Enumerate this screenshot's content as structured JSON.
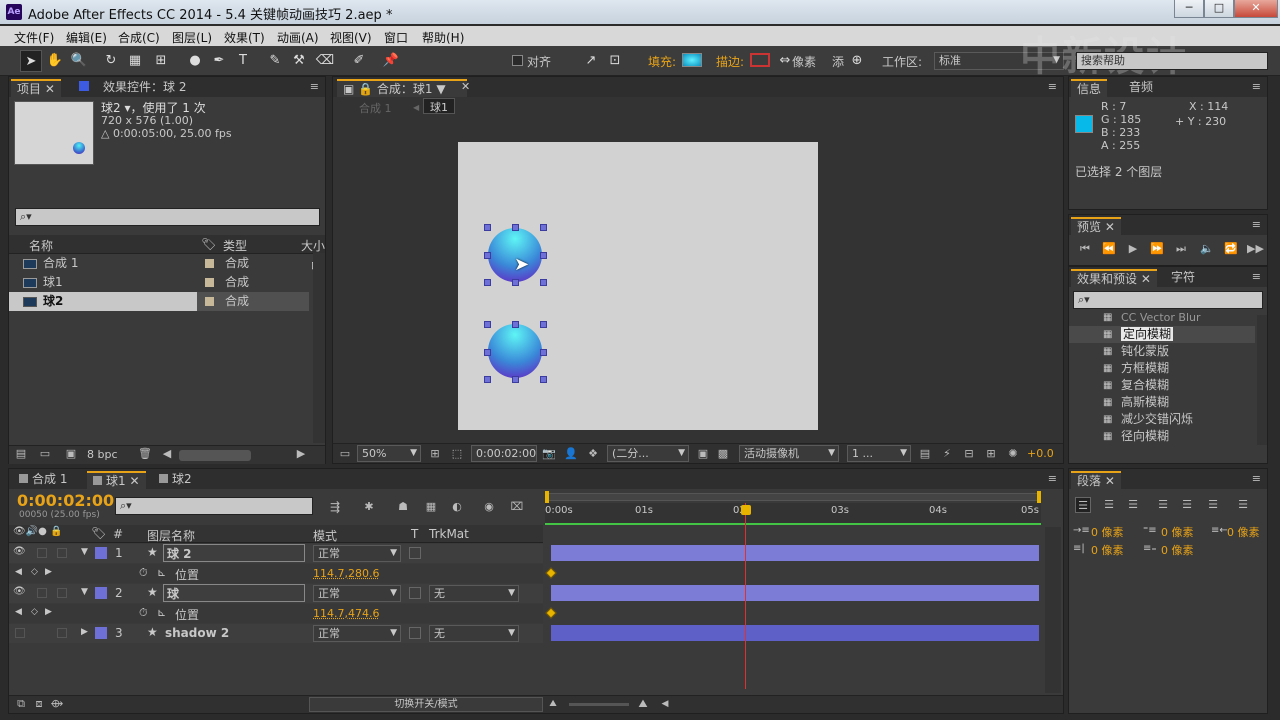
{
  "window": {
    "title": "Adobe After Effects CC 2014 - 5.4 关键帧动画技巧 2.aep *",
    "app_icon": "Ae",
    "min": "─",
    "max": "□",
    "close": "✕"
  },
  "menu": [
    "文件(F)",
    "编辑(E)",
    "合成(C)",
    "图层(L)",
    "效果(T)",
    "动画(A)",
    "视图(V)",
    "窗口",
    "帮助(H)"
  ],
  "toolbar": {
    "snap_label": "对齐",
    "fill_label": "填充:",
    "stroke_label": "描边:",
    "stroke_unit": "像素",
    "add_label": "添",
    "workspace_label": "工作区:",
    "workspace_value": "标准",
    "search_help": "搜索帮助",
    "fill_color": "#18b9e9"
  },
  "watermark": "中新设计",
  "project": {
    "tab_label": "项目",
    "effects_tab": "效果控件：球 2",
    "item_name": "球2 ▾，使用了 1 次",
    "item_size": "720 x 576 (1.00)",
    "item_duration": "△ 0:00:05:00, 25.00 fps",
    "search_placeholder": "⌕▾",
    "columns": {
      "name": "名称",
      "type": "类型",
      "size": "大小"
    },
    "items": [
      {
        "name": "合成 1",
        "type": "合成"
      },
      {
        "name": "球1",
        "type": "合成"
      },
      {
        "name": "球2",
        "type": "合成"
      }
    ],
    "bpc": "8 bpc"
  },
  "composition": {
    "tab_label": "合成：球1",
    "breadcrumbs": [
      "合成 1",
      "球1"
    ],
    "zoom": "50%",
    "timecode": "0:00:02:00",
    "resolution": "(二分...",
    "camera": "活动摄像机",
    "views": "1 ...",
    "exposure": "+0.0"
  },
  "info": {
    "tab_label": "信息",
    "audio_tab": "音频",
    "r": "R : 7",
    "g": "G : 185",
    "b": "B : 233",
    "a": "A : 255",
    "x": "X : 114",
    "y": "+ Y : 230",
    "swatch": "#07b9e9",
    "selected": "已选择 2 个图层"
  },
  "preview": {
    "tab_label": "预览"
  },
  "effects": {
    "tab_label": "效果和预设",
    "char_tab": "字符",
    "search_placeholder": "⌕▾",
    "items": [
      "CC Vector Blur",
      "定向模糊",
      "钝化蒙版",
      "方框模糊",
      "复合模糊",
      "高斯模糊",
      "减少交错闪烁",
      "径向模糊"
    ]
  },
  "timeline": {
    "tabs": [
      "合成 1",
      "球1",
      "球2"
    ],
    "timecode": "0:00:02:00",
    "frame_info": "00050 (25.00 fps)",
    "search_placeholder": "⌕▾",
    "columns": {
      "num": "#",
      "layer_name": "图层名称",
      "mode": "模式",
      "t": "T",
      "trkmat": "TrkMat"
    },
    "ruler": [
      "0:00s",
      "01s",
      "02s",
      "03s",
      "04s",
      "05s"
    ],
    "layers": [
      {
        "num": "1",
        "name": "球 2",
        "mode": "正常",
        "prop": "位置",
        "value": "114.7,280.6",
        "trkmat": ""
      },
      {
        "num": "2",
        "name": "球",
        "mode": "正常",
        "prop": "位置",
        "value": "114.7,474.6",
        "trkmat": "无"
      },
      {
        "num": "3",
        "name": "shadow 2",
        "mode": "正常",
        "trkmat": "无"
      }
    ],
    "footer": "切换开关/模式",
    "playhead_fraction": 0.4
  },
  "paragraph": {
    "tab_label": "段落",
    "indent_labels": [
      "0 像素",
      "0 像素",
      "0 像素",
      "0 像素",
      "0 像素"
    ]
  }
}
